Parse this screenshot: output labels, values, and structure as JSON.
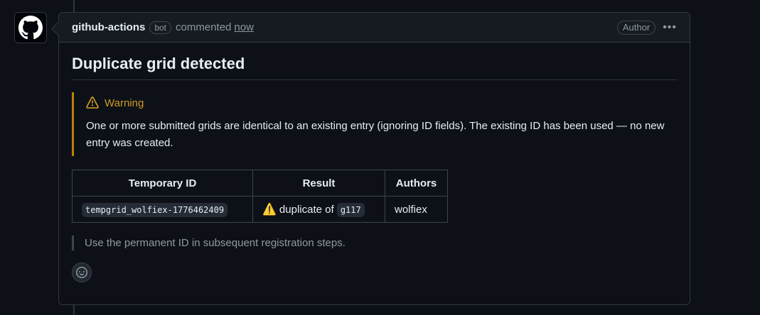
{
  "comment": {
    "author": "github-actions",
    "bot_label": "bot",
    "action": "commented",
    "time": "now",
    "role_badge": "Author",
    "menu_glyph": "•••"
  },
  "content": {
    "heading": "Duplicate grid detected",
    "alert": {
      "title": "Warning",
      "text": "One or more submitted grids are identical to an existing entry (ignoring ID fields). The existing ID has been used — no new entry was created.",
      "color": "#d29922"
    },
    "table": {
      "headers": [
        "Temporary ID",
        "Result",
        "Authors"
      ],
      "rows": [
        {
          "temp_id": "tempgrid_wolfiex-1776462409",
          "result_emoji": "⚠️",
          "result_text": "duplicate of",
          "result_code": "g117",
          "authors": "wolfiex"
        }
      ]
    },
    "quote": "Use the permanent ID in subsequent registration steps."
  },
  "icons": {
    "avatar": "github-mark-icon",
    "alert": "alert-triangle-icon",
    "reaction": "smiley-icon"
  }
}
